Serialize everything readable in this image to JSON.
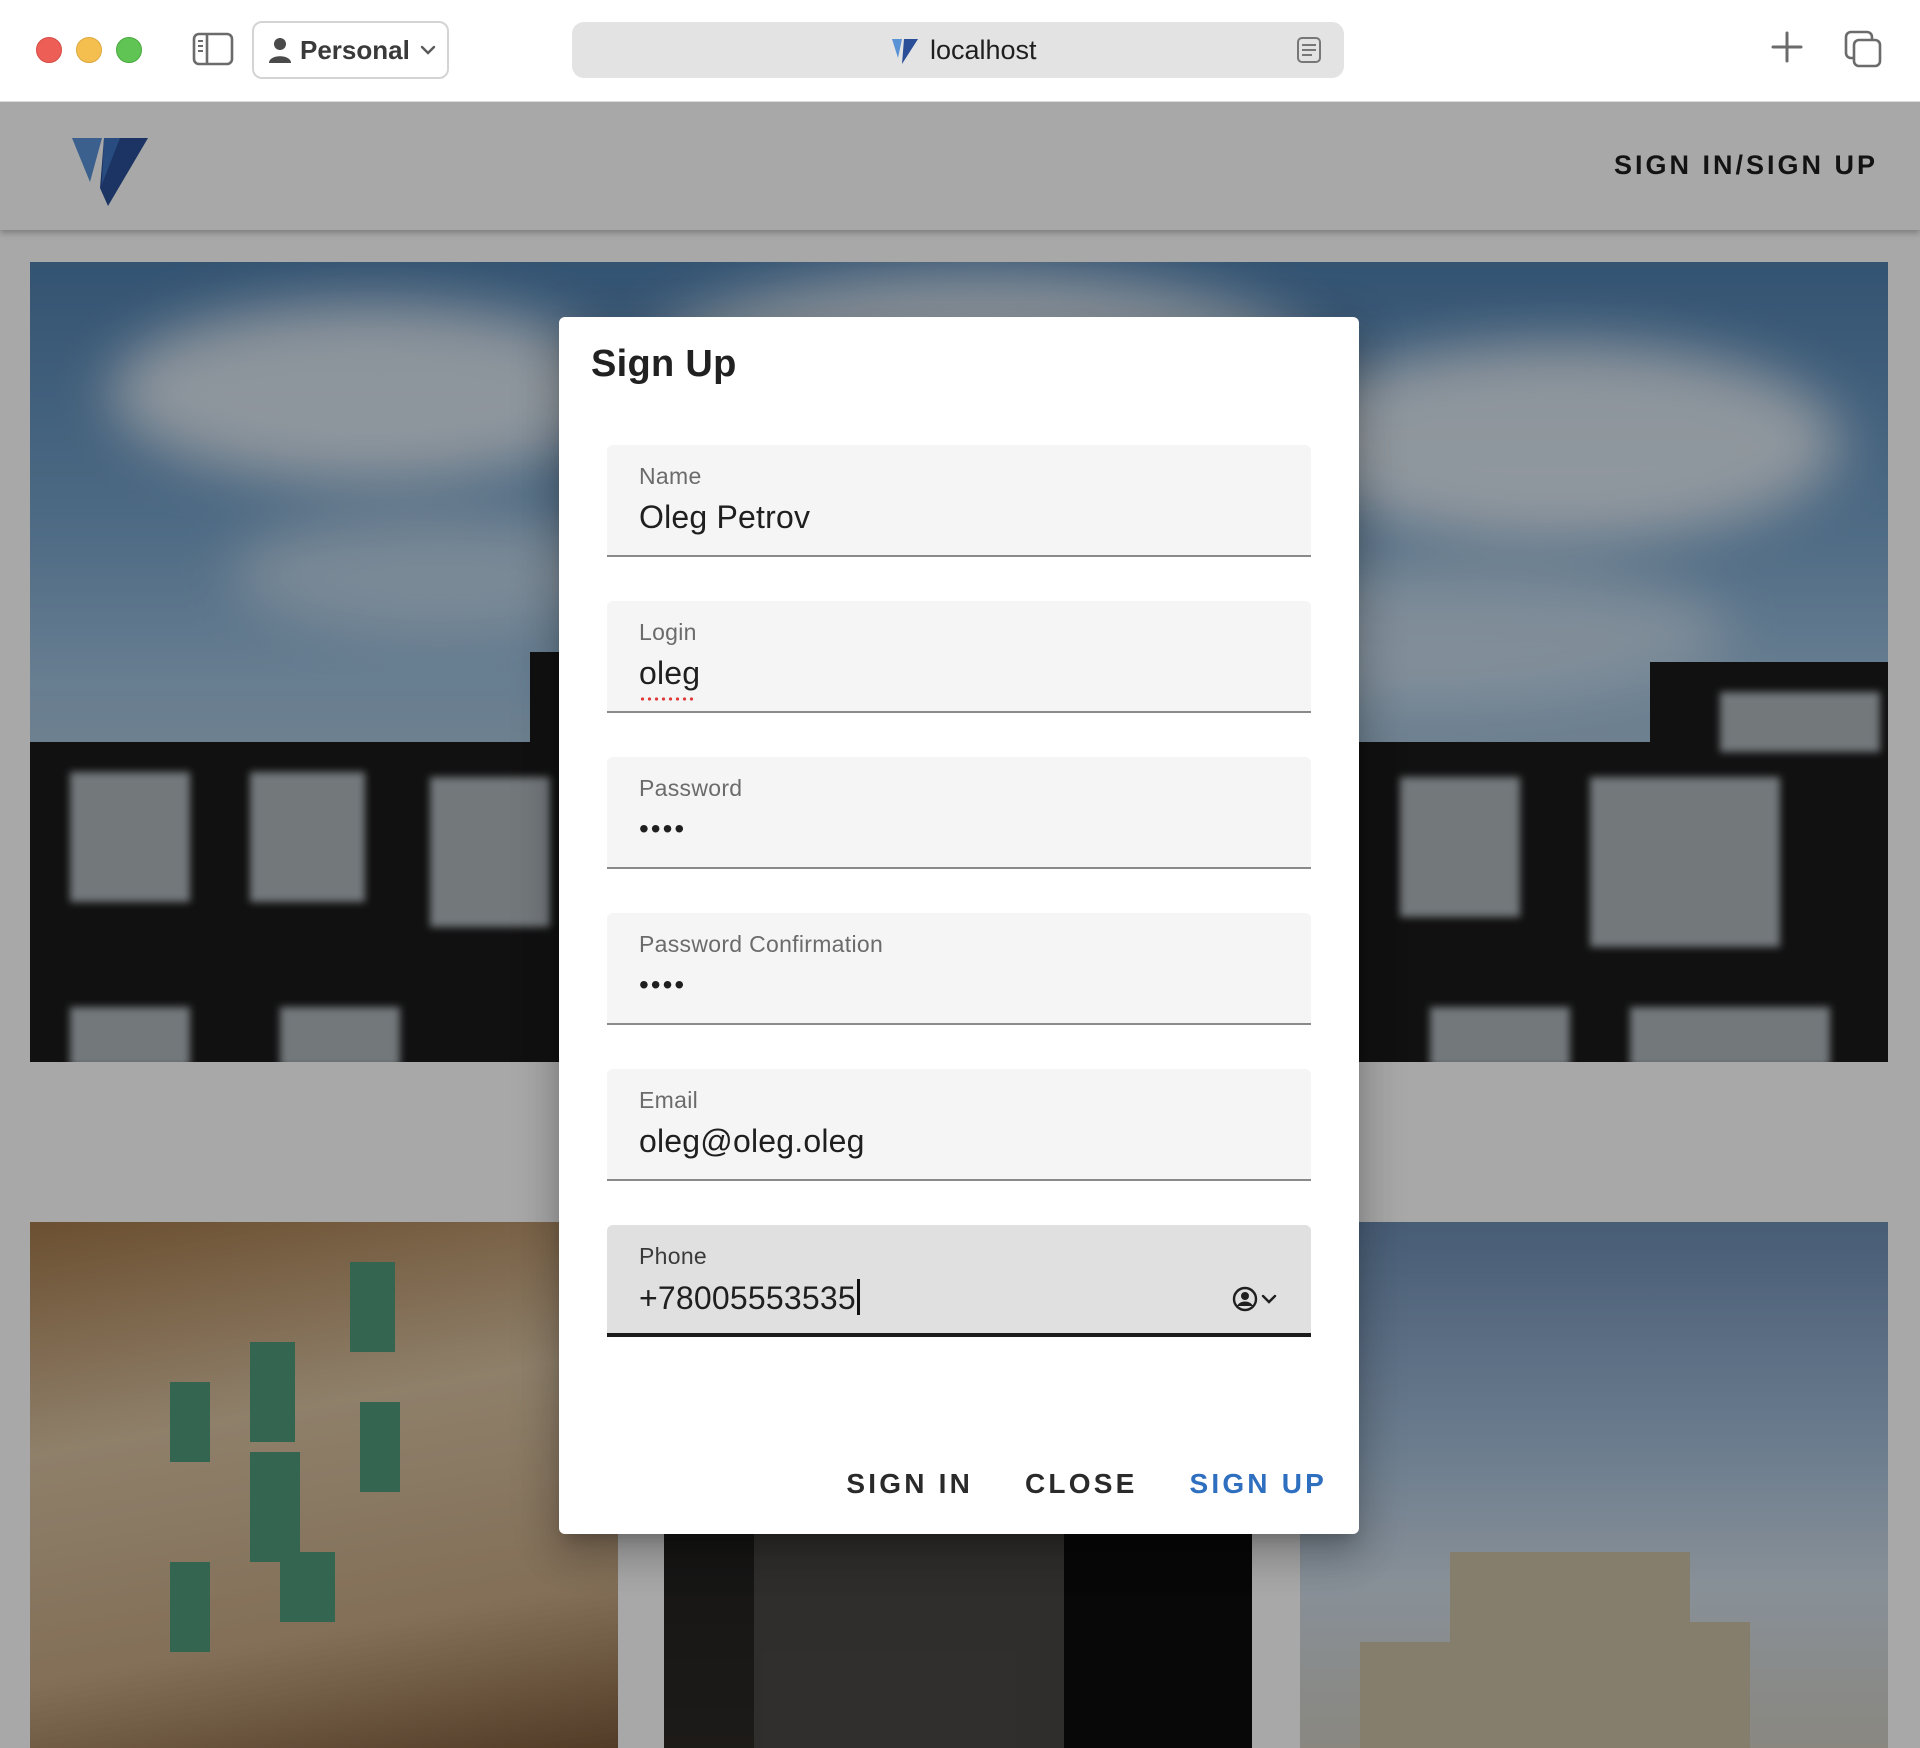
{
  "browser": {
    "profile_label": "Personal",
    "url": "localhost"
  },
  "appbar": {
    "auth_link": "SIGN IN/SIGN UP"
  },
  "dialog": {
    "title": "Sign Up",
    "fields": [
      {
        "label": "Name",
        "value": "Oleg Petrov"
      },
      {
        "label": "Login",
        "value": "oleg"
      },
      {
        "label": "Password",
        "value": "••••"
      },
      {
        "label": "Password Confirmation",
        "value": "••••"
      },
      {
        "label": "Email",
        "value": "oleg@oleg.oleg"
      },
      {
        "label": "Phone",
        "value": "+78005553535"
      }
    ],
    "actions": {
      "sign_in": "SIGN IN",
      "close": "CLOSE",
      "sign_up": "SIGN UP"
    }
  },
  "colors": {
    "primary_action": "#2f6fbf",
    "logo_dark": "#2a4f98",
    "logo_light": "#5a92d6"
  }
}
